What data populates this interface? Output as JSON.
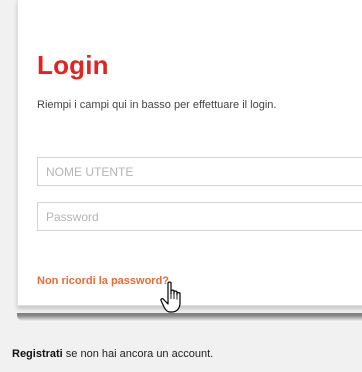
{
  "login": {
    "title": "Login",
    "subtitle": "Riempi i campi qui in basso per effettuare il login.",
    "username_placeholder": "NOME UTENTE",
    "password_placeholder": "Password",
    "forgot_password": "Non ricordi la password?"
  },
  "register": {
    "link_label": "Registrati",
    "suffix": " se non hai ancora un account."
  },
  "colors": {
    "title": "#e4231f",
    "link": "#e96a32"
  },
  "icons": {
    "cursor": "hand-pointer-icon"
  }
}
